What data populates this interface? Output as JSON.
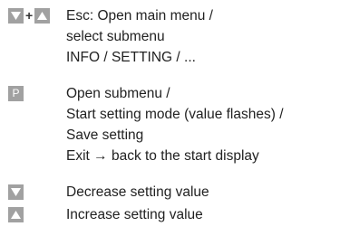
{
  "rows": [
    {
      "keys": [
        "down-arrow",
        "up-arrow"
      ],
      "separator": "+",
      "lines": [
        "Esc: Open main menu /",
        "select submenu",
        "INFO / SETTING / ..."
      ]
    },
    {
      "keys": [
        "P"
      ],
      "lines": [
        "Open submenu /",
        "Start setting mode (value flashes) /",
        "Save setting",
        "Exit → back to the start display"
      ]
    },
    {
      "keys": [
        "down-arrow"
      ],
      "lines": [
        "Decrease setting value"
      ]
    },
    {
      "keys": [
        "up-arrow"
      ],
      "lines": [
        "Increase setting value"
      ]
    }
  ],
  "colors": {
    "key_background": "#a1a1a1",
    "key_glyph": "#ffffff",
    "text": "#222222"
  }
}
